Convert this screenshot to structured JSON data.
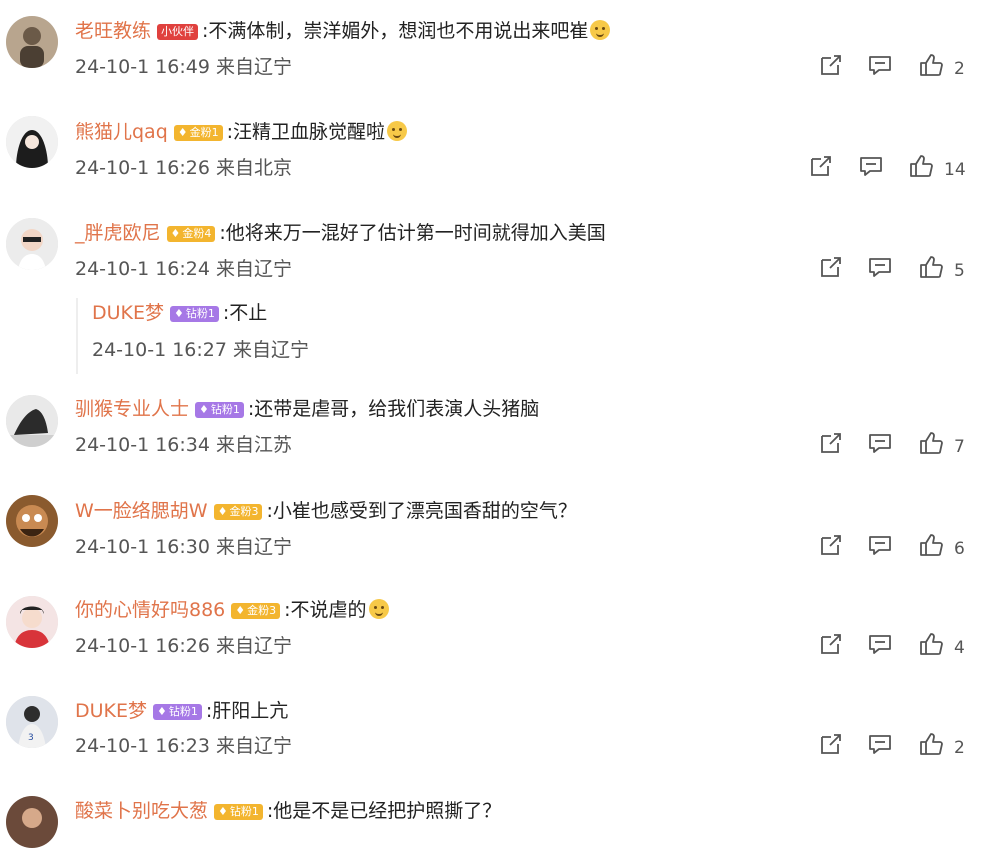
{
  "colors": {
    "username": "#e0744a",
    "badge_red": "#e0413e",
    "badge_gold": "#f3b52f",
    "badge_purple": "#a678e6"
  },
  "comments": [
    {
      "user": "老旺教练",
      "badge": "小伙伴",
      "badge_type": "red",
      "text": ":不满体制，崇洋媚外，想润也不用说出来吧崔",
      "time": "24-10-1 16:49",
      "location": "来自辽宁",
      "likes": "2"
    },
    {
      "user": "熊猫儿qaq",
      "badge": "金粉1",
      "badge_type": "gold",
      "text": ":汪精卫血脉觉醒啦",
      "time": "24-10-1 16:26",
      "location": "来自北京",
      "likes": "14"
    },
    {
      "user": "_胖虎欧尼",
      "badge": "金粉4",
      "badge_type": "gold",
      "text": ":他将来万一混好了估计第一时间就得加入美国",
      "time": "24-10-1 16:24",
      "location": "来自辽宁",
      "likes": "5",
      "reply": {
        "user": "DUKE梦",
        "badge": "钻粉1",
        "badge_type": "purple",
        "text": ":不止",
        "time": "24-10-1 16:27",
        "location": "来自辽宁"
      }
    },
    {
      "user": "驯猴专业人士",
      "badge": "钻粉1",
      "badge_type": "purple",
      "text": ":还带是虐哥，给我们表演人头猪脑",
      "time": "24-10-1 16:34",
      "location": "来自江苏",
      "likes": "7"
    },
    {
      "user": "W一脸络腮胡W",
      "badge": "金粉3",
      "badge_type": "gold",
      "text": ":小崔也感受到了漂亮国香甜的空气？",
      "time": "24-10-1 16:30",
      "location": "来自辽宁",
      "likes": "6"
    },
    {
      "user": "你的心情好吗886",
      "badge": "金粉3",
      "badge_type": "gold",
      "text": ":不说虐的",
      "time": "24-10-1 16:26",
      "location": "来自辽宁",
      "likes": "4"
    },
    {
      "user": "DUKE梦",
      "badge": "钻粉1",
      "badge_type": "purple",
      "text": ":肝阳上亢",
      "time": "24-10-1 16:23",
      "location": "来自辽宁",
      "likes": "2"
    },
    {
      "user": "酸菜卜别吃大葱",
      "badge": "钻粉1",
      "badge_type": "gold",
      "text": ":他是不是已经把护照撕了？"
    }
  ],
  "icons": {
    "share": "share-icon",
    "comment": "comment-icon",
    "like": "thumbs-up-icon"
  }
}
